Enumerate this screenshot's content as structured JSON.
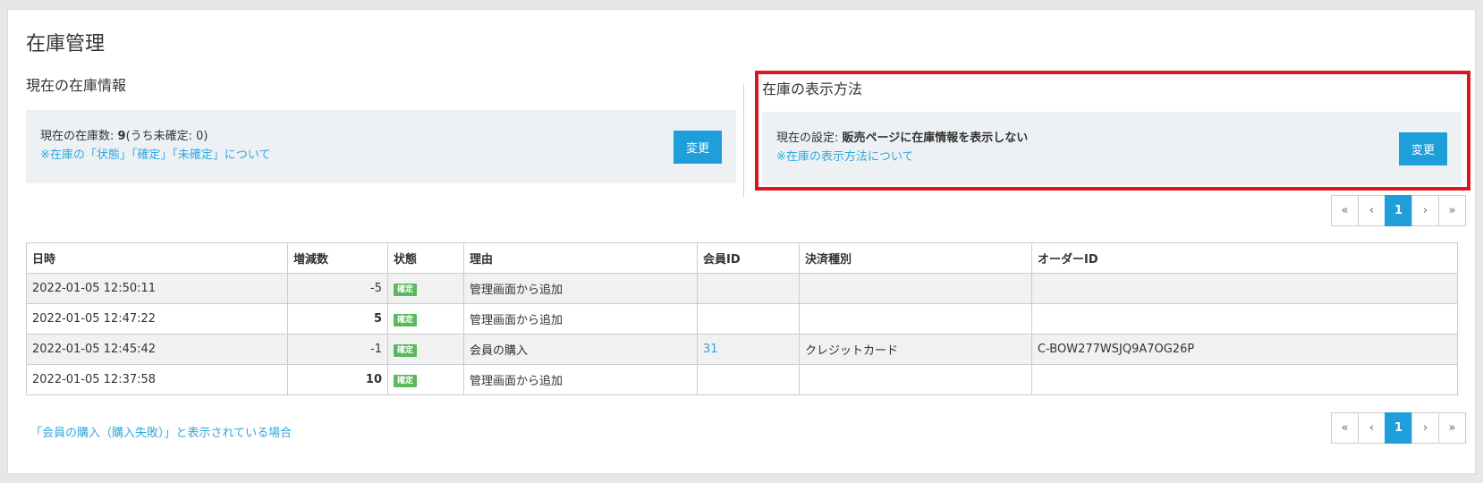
{
  "page": {
    "title": "在庫管理"
  },
  "current_stock": {
    "heading": "現在の在庫情報",
    "label": "現在の在庫数: ",
    "count": "9",
    "unconfirmed": "(うち未確定: 0)",
    "help_link": "※在庫の「状態」「確定」「未確定」について",
    "button": "変更"
  },
  "display_method": {
    "heading": "在庫の表示方法",
    "label": "現在の設定: ",
    "value": "販売ページに在庫情報を表示しない",
    "help_link": "※在庫の表示方法について",
    "button": "変更"
  },
  "pager": {
    "first": "«",
    "prev": "‹",
    "current": "1",
    "next": "›",
    "last": "»"
  },
  "table": {
    "headers": [
      "日時",
      "増減数",
      "状態",
      "理由",
      "会員ID",
      "決済種別",
      "オーダーID"
    ],
    "rows": [
      {
        "datetime": "2022-01-05 12:50:11",
        "delta": "-5",
        "status": "確定",
        "reason": "管理画面から追加",
        "member_id": "",
        "payment": "",
        "order_id": ""
      },
      {
        "datetime": "2022-01-05 12:47:22",
        "delta": "5",
        "status": "確定",
        "reason": "管理画面から追加",
        "member_id": "",
        "payment": "",
        "order_id": ""
      },
      {
        "datetime": "2022-01-05 12:45:42",
        "delta": "-1",
        "status": "確定",
        "reason": "会員の購入",
        "member_id": "31",
        "payment": "クレジットカード",
        "order_id": "C-BOW277WSJQ9A7OG26P"
      },
      {
        "datetime": "2022-01-05 12:37:58",
        "delta": "10",
        "status": "確定",
        "reason": "管理画面から追加",
        "member_id": "",
        "payment": "",
        "order_id": ""
      }
    ]
  },
  "footer_link": "「会員の購入（購入失敗）」と表示されている場合",
  "colors": {
    "accent": "#1e9fdb",
    "highlight_border": "#e0141e",
    "badge": "#5cb85c"
  }
}
